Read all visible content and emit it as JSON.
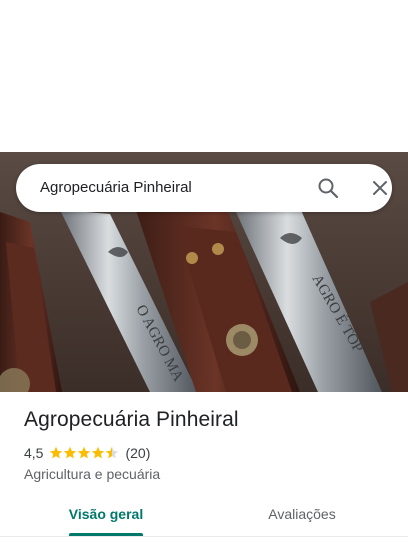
{
  "search": {
    "query": "Agropecuária Pinheiral"
  },
  "hero": {
    "photo_alt": "knives in leather sheaths",
    "blade_text_left": "O AGRO MA",
    "blade_text_right": "AGRO É TOP"
  },
  "place": {
    "title": "Agropecuária Pinheiral",
    "rating": "4,5",
    "rating_value": 4.5,
    "review_count": "(20)",
    "category": "Agricultura e pecuária"
  },
  "tabs": [
    {
      "label": "Visão geral",
      "active": true
    },
    {
      "label": "Avaliações",
      "active": false
    }
  ],
  "colors": {
    "accent": "#00796b",
    "star": "#fbbc04",
    "star_empty": "#dadce0",
    "text_primary": "#202124",
    "text_secondary": "#5f6368"
  },
  "icons": {
    "search": "search-icon",
    "close": "close-icon",
    "star": "star-icon"
  }
}
